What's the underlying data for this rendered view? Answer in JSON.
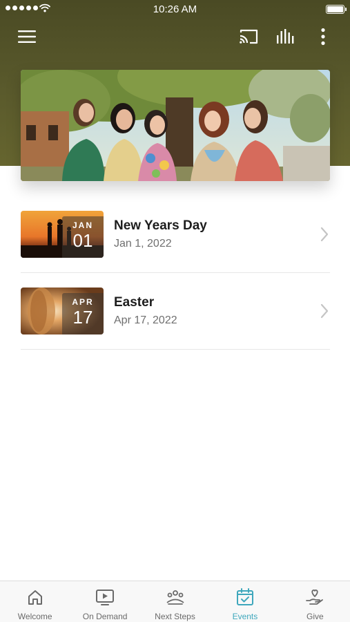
{
  "status_bar": {
    "time": "10:26 AM"
  },
  "toolbar": {
    "menu_icon": "hamburger-menu-icon",
    "cast_icon": "cast-icon",
    "audio_icon": "equalizer-icon",
    "more_icon": "more-vertical-icon"
  },
  "colors": {
    "header": "#5a5a2c",
    "accent": "#3ea7bc",
    "tab_inactive": "#6a6a6a"
  },
  "events": [
    {
      "title": "New Years Day",
      "date": "Jan 1, 2022",
      "month": "JAN",
      "day": "01"
    },
    {
      "title": "Easter",
      "date": "Apr 17, 2022",
      "month": "APR",
      "day": "17"
    }
  ],
  "tabs": [
    {
      "label": "Welcome",
      "icon": "home-icon",
      "active": false
    },
    {
      "label": "On Demand",
      "icon": "video-play-icon",
      "active": false
    },
    {
      "label": "Next Steps",
      "icon": "people-group-icon",
      "active": false
    },
    {
      "label": "Events",
      "icon": "calendar-check-icon",
      "active": true
    },
    {
      "label": "Give",
      "icon": "hand-heart-icon",
      "active": false
    }
  ]
}
